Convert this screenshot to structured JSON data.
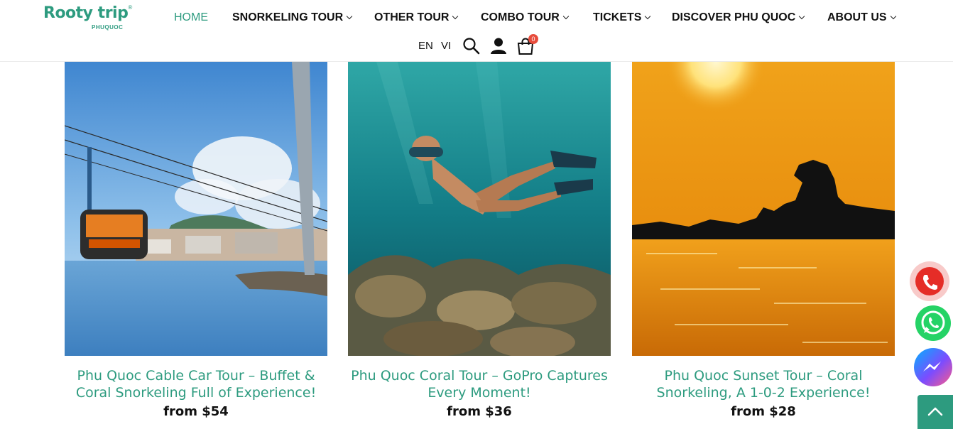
{
  "brand": {
    "name": "Rooty trip",
    "registered": "®",
    "sub": "PHUQUOC"
  },
  "nav": {
    "items": [
      {
        "label": "HOME",
        "active": true
      },
      {
        "label": "SNORKELING TOUR"
      },
      {
        "label": "OTHER TOUR"
      },
      {
        "label": "COMBO TOUR"
      },
      {
        "label": "TICKETS"
      },
      {
        "label": "DISCOVER PHU QUOC"
      },
      {
        "label": "ABOUT US"
      }
    ]
  },
  "utility": {
    "lang_en": "EN",
    "lang_vi": "VI",
    "cart_count": "0",
    "icons": [
      "search-icon",
      "user-icon",
      "cart-icon"
    ]
  },
  "tours": [
    {
      "title": "Phu Quoc Cable Car Tour – Buffet & Coral Snorkeling Full of Experience!",
      "price": "from $54"
    },
    {
      "title": "Phu Quoc Coral Tour – GoPro Captures Every Moment!",
      "price": "from $36"
    },
    {
      "title": "Phu Quoc Sunset Tour – Coral Snorkeling, A 1-0-2 Experience!",
      "price": "from $28"
    }
  ],
  "floating": {
    "icons": [
      "phone-icon",
      "whatsapp-icon",
      "messenger-icon",
      "arrow-up-icon"
    ]
  },
  "colors": {
    "accent": "#2d9b7f",
    "phone": "#e52d27",
    "whatsapp": "#25d366",
    "messenger": "#7b4cff"
  }
}
